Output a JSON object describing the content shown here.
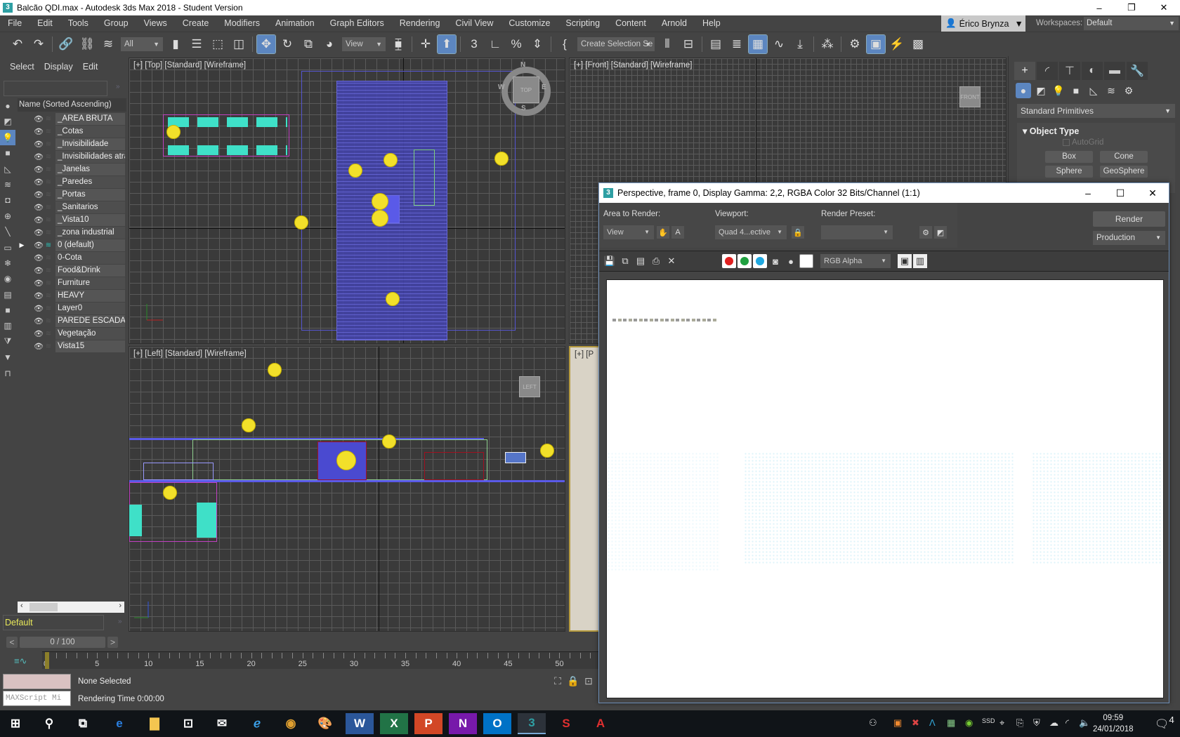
{
  "app": {
    "title": "Balcão QDI.max - Autodesk 3ds Max 2018 - Student Version",
    "icon_label": "3",
    "window_buttons": [
      "–",
      "❐",
      "✕"
    ]
  },
  "menu": [
    "File",
    "Edit",
    "Tools",
    "Group",
    "Views",
    "Create",
    "Modifiers",
    "Animation",
    "Graph Editors",
    "Rendering",
    "Civil View",
    "Customize",
    "Scripting",
    "Content",
    "Arnold",
    "Help"
  ],
  "user": {
    "name": "Érico Brynza",
    "caret": "▼"
  },
  "workspaces": {
    "label": "Workspaces:",
    "value": "Default"
  },
  "toolbar": {
    "selection_filter": "All",
    "ref_coord": "View",
    "named_selection": "Create Selection Se"
  },
  "explorer": {
    "tabs": [
      "Select",
      "Display",
      "Edit"
    ],
    "more": "»",
    "column_header": "Name (Sorted Ascending)",
    "layers": [
      {
        "name": "_AREA BRUTA",
        "current": false
      },
      {
        "name": "_Cotas",
        "current": false
      },
      {
        "name": "_Invisibilidade",
        "current": false
      },
      {
        "name": "_Invisibilidades atraz",
        "current": false
      },
      {
        "name": "_Janelas",
        "current": false
      },
      {
        "name": "_Paredes",
        "current": false
      },
      {
        "name": "_Portas",
        "current": false
      },
      {
        "name": "_Sanitarios",
        "current": false
      },
      {
        "name": "_Vista10",
        "current": false
      },
      {
        "name": "_zona industrial",
        "current": false
      },
      {
        "name": "0 (default)",
        "current": true
      },
      {
        "name": "0-Cota",
        "current": false
      },
      {
        "name": "Food&Drink",
        "current": false
      },
      {
        "name": "Furniture",
        "current": false
      },
      {
        "name": "HEAVY",
        "current": false
      },
      {
        "name": "Layer0",
        "current": false
      },
      {
        "name": "PAREDE ESCADA",
        "current": false
      },
      {
        "name": "Vegetação",
        "current": false
      },
      {
        "name": "Vista15",
        "current": false
      }
    ],
    "current_layer": "Default"
  },
  "viewports": {
    "top": {
      "label": "[+] [Top] [Standard] [Wireframe]",
      "cube": "TOP",
      "compass": [
        "N",
        "S",
        "E",
        "W"
      ]
    },
    "front": {
      "label": "[+] [Front] [Standard] [Wireframe]",
      "cube": "FRONT"
    },
    "left": {
      "label": "[+] [Left] [Standard] [Wireframe]",
      "cube": "LEFT"
    },
    "perspective": {
      "label": "[+] [P"
    }
  },
  "command_panel": {
    "tabs": [
      "create",
      "modify",
      "hierarchy",
      "motion",
      "display",
      "utilities"
    ],
    "category": "Standard Primitives",
    "rollout_title": "Object Type",
    "autogrid": "AutoGrid",
    "buttons": [
      "Box",
      "Cone",
      "Sphere",
      "GeoSphere"
    ]
  },
  "timeline": {
    "frame_display": "0 / 100",
    "prev": "<",
    "next": ">",
    "current_frame": 0,
    "total_frames": 100,
    "tick_labels": [
      "0",
      "5",
      "10",
      "15",
      "20",
      "25",
      "30",
      "35",
      "40",
      "45",
      "50"
    ]
  },
  "status": {
    "maxscript_placeholder": "MAXScript Mi",
    "selection": "None Selected",
    "rendering_time": "Rendering Time  0:00:00"
  },
  "render_window": {
    "title": "Perspective, frame 0, Display Gamma: 2,2, RGBA Color 32 Bits/Channel (1:1)",
    "area_label": "Area to Render:",
    "area_value": "View",
    "viewport_label": "Viewport:",
    "viewport_value": "Quad 4...ective",
    "preset_label": "Render Preset:",
    "preset_value": "",
    "render_button": "Render",
    "render_mode": "Production",
    "channel": "RGB Alpha",
    "channel_colors": {
      "red": "#e02020",
      "green": "#20a040",
      "blue": "#20a8e0"
    }
  },
  "taskbar": {
    "apps": [
      "windows",
      "search",
      "task-view",
      "edge",
      "file-explorer",
      "store",
      "mail",
      "ie",
      "chrome",
      "paint",
      "word",
      "excel",
      "powerpoint",
      "onenote",
      "outlook",
      "3dsmax",
      "sketchup",
      "autocad"
    ],
    "active": "3dsmax",
    "time": "09:59",
    "date": "24/01/2018",
    "notifications": "4"
  }
}
